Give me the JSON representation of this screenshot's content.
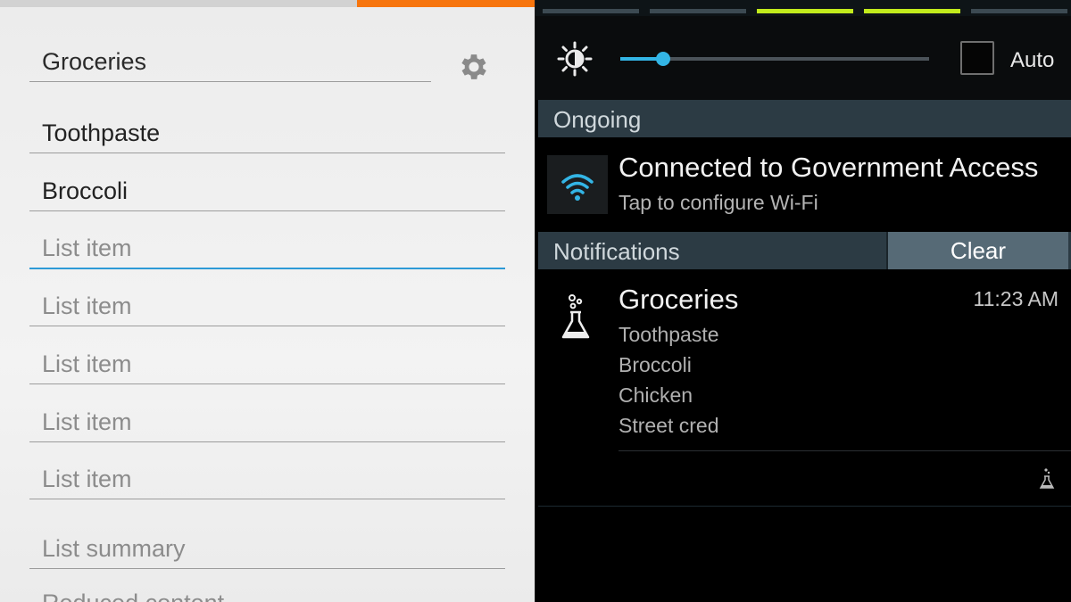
{
  "editor": {
    "title_value": "Groceries",
    "items": [
      {
        "value": "Toothpaste",
        "placeholder": "List item"
      },
      {
        "value": "Broccoli",
        "placeholder": "List item"
      },
      {
        "value": "",
        "placeholder": "List item"
      },
      {
        "value": "",
        "placeholder": "List item"
      },
      {
        "value": "",
        "placeholder": "List item"
      },
      {
        "value": "",
        "placeholder": "List item"
      },
      {
        "value": "",
        "placeholder": "List item"
      }
    ],
    "summary_placeholder": "List summary",
    "reduced_placeholder": "Reduced content",
    "icons": {
      "settings": "gear-icon"
    },
    "colors": {
      "accent": "#f7750d",
      "focus": "#2d9ad6"
    }
  },
  "shade": {
    "quick_settings": {
      "toggles": [
        {
          "state": "off"
        },
        {
          "state": "off"
        },
        {
          "state": "on"
        },
        {
          "state": "on"
        },
        {
          "state": "off"
        }
      ]
    },
    "brightness": {
      "level": 0.14,
      "auto_label": "Auto",
      "auto_checked": false
    },
    "ongoing": {
      "header": "Ongoing",
      "item": {
        "title": "Connected to Government Access",
        "subtitle": "Tap to configure Wi-Fi",
        "icon": "wifi-icon"
      }
    },
    "notifications": {
      "header": "Notifications",
      "clear_label": "Clear",
      "item": {
        "title": "Groceries",
        "time": "11:23 AM",
        "lines": [
          "Toothpaste",
          "Broccoli",
          "Chicken",
          "Street cred"
        ],
        "icon": "flask-icon"
      }
    },
    "colors": {
      "accent": "#33b5e5",
      "toggle_on": "#c2eb1c"
    }
  }
}
